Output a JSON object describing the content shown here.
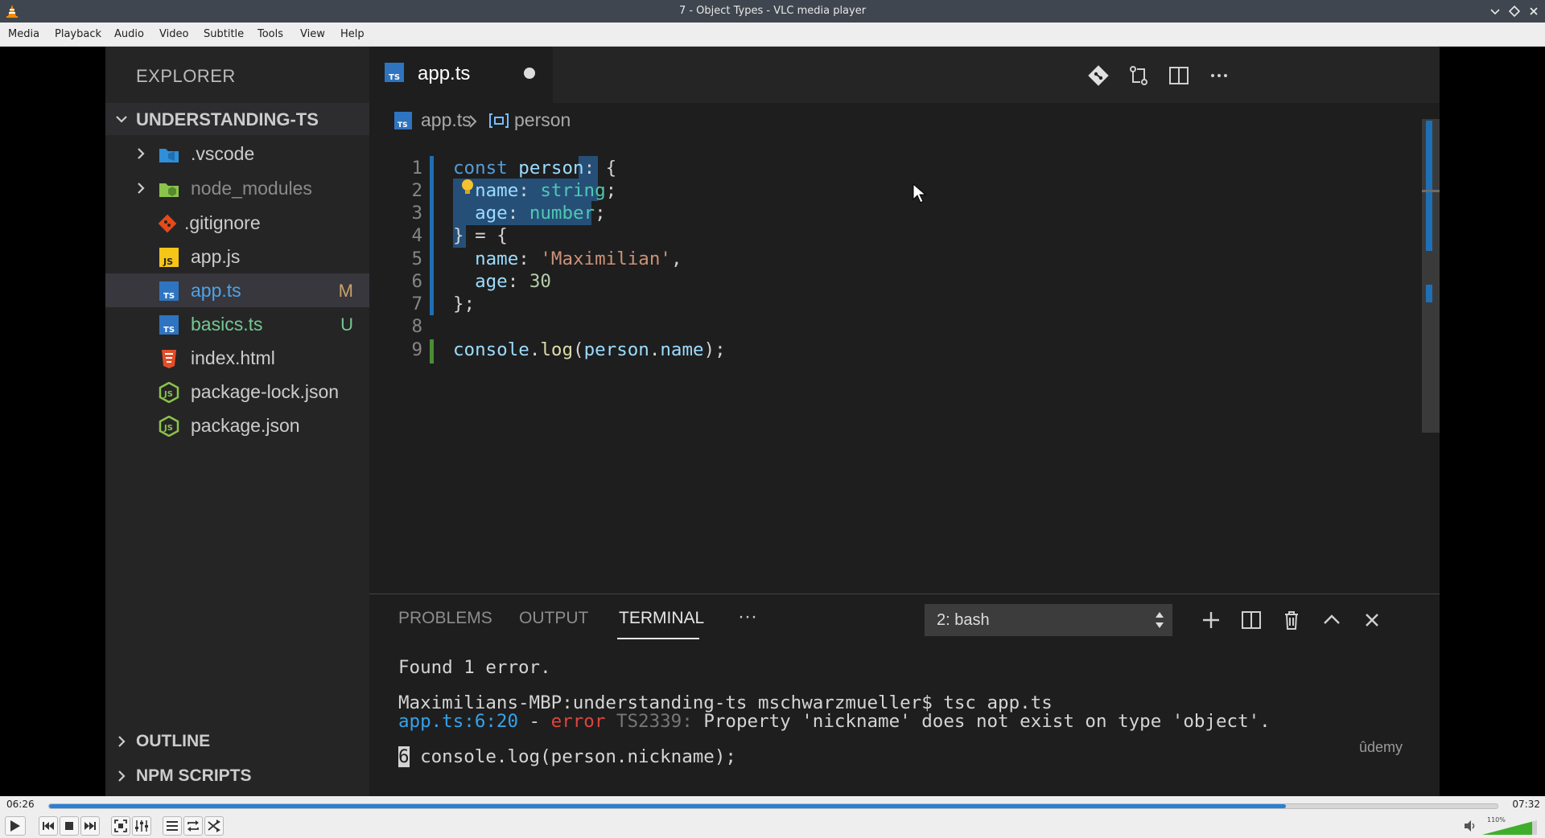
{
  "window": {
    "title": "7 - Object Types - VLC media player"
  },
  "menu": {
    "items": [
      "Media",
      "Playback",
      "Audio",
      "Video",
      "Subtitle",
      "Tools",
      "View",
      "Help"
    ]
  },
  "vscode": {
    "explorer_title": "EXPLORER",
    "project_name": "UNDERSTANDING-TS",
    "files": [
      {
        "name": ".vscode",
        "icon": "folder-vscode-icon",
        "status": ""
      },
      {
        "name": "node_modules",
        "icon": "folder-node-icon",
        "status": ""
      },
      {
        "name": ".gitignore",
        "icon": "git-icon",
        "status": ""
      },
      {
        "name": "app.js",
        "icon": "js-file-icon",
        "status": ""
      },
      {
        "name": "app.ts",
        "icon": "ts-file-icon",
        "status": "M"
      },
      {
        "name": "basics.ts",
        "icon": "ts-file-icon",
        "status": "U"
      },
      {
        "name": "index.html",
        "icon": "html-file-icon",
        "status": ""
      },
      {
        "name": "package-lock.json",
        "icon": "node-json-icon",
        "status": ""
      },
      {
        "name": "package.json",
        "icon": "node-json-icon",
        "status": ""
      }
    ],
    "sections": [
      "OUTLINE",
      "NPM SCRIPTS"
    ],
    "tab": {
      "name": "app.ts",
      "dirty": true
    },
    "breadcrumb": {
      "file": "app.ts",
      "symbol": "person"
    },
    "line_numbers": [
      "1",
      "2",
      "3",
      "4",
      "5",
      "6",
      "7",
      "8",
      "9"
    ],
    "code_lines": [
      "const person: {",
      "  name: string;",
      "  age: number;",
      "} = {",
      "  name: 'Maximilian',",
      "  age: 30",
      "};",
      "",
      "console.log(person.name);"
    ],
    "panel": {
      "tabs": [
        "PROBLEMS",
        "OUTPUT",
        "TERMINAL"
      ],
      "active_tab": "TERMINAL",
      "more": "···",
      "shell_select": "2: bash",
      "terminal": {
        "line1": "Found 1 error.",
        "prompt": "Maximilians-MBP:understanding-ts mschwarzmueller$ tsc app.ts",
        "err_loc": "app.ts:6:20",
        "err_dash": " - ",
        "err_word": "error",
        "err_code": " TS2339: ",
        "err_msg": "Property 'nickname' does not exist on type 'object'.",
        "src_lineno": "6",
        "src_code": " console.log(person.nickname);"
      },
      "watermark": "ûdemy"
    }
  },
  "player": {
    "time_current": "06:26",
    "time_total": "07:32",
    "progress": 0.854,
    "volume_label": "110%",
    "accent": "#2a7fd4"
  }
}
